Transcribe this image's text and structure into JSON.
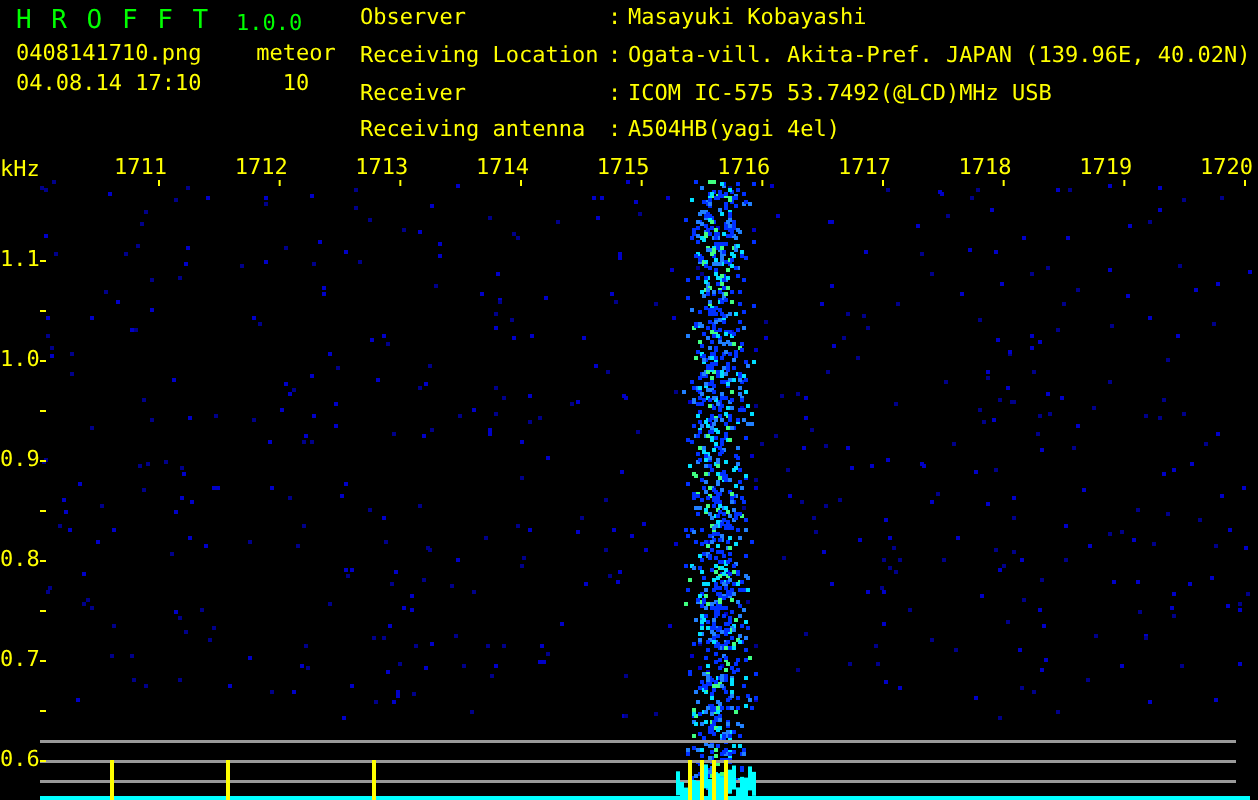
{
  "app": {
    "title": "H R O F F T",
    "version": "1.0.0"
  },
  "capture": {
    "file": "0408141710.png",
    "timestamp": "04.08.14 17:10",
    "count_label": "meteor",
    "count": "10"
  },
  "info": [
    {
      "label": "Observer",
      "separator": ":",
      "value": "Masayuki Kobayashi"
    },
    {
      "label": "Receiving Location",
      "separator": ":",
      "value": "Ogata-vill. Akita-Pref. JAPAN (139.96E, 40.02N)"
    },
    {
      "label": "Receiver",
      "separator": ":",
      "value": "ICOM IC-575 53.7492(@LCD)MHz USB"
    },
    {
      "label": "Receiving antenna",
      "separator": ":",
      "value": "A504HB(yagi 4el)"
    }
  ],
  "spectrogram": {
    "y_unit": "kHz",
    "x_labels": [
      "1711",
      "1712",
      "1713",
      "1714",
      "1715",
      "1716",
      "1717",
      "1718",
      "1719",
      "1720"
    ],
    "y_labels": [
      "1.1",
      "1.0",
      "0.9",
      "0.8",
      "0.7",
      "0.6"
    ]
  }
}
